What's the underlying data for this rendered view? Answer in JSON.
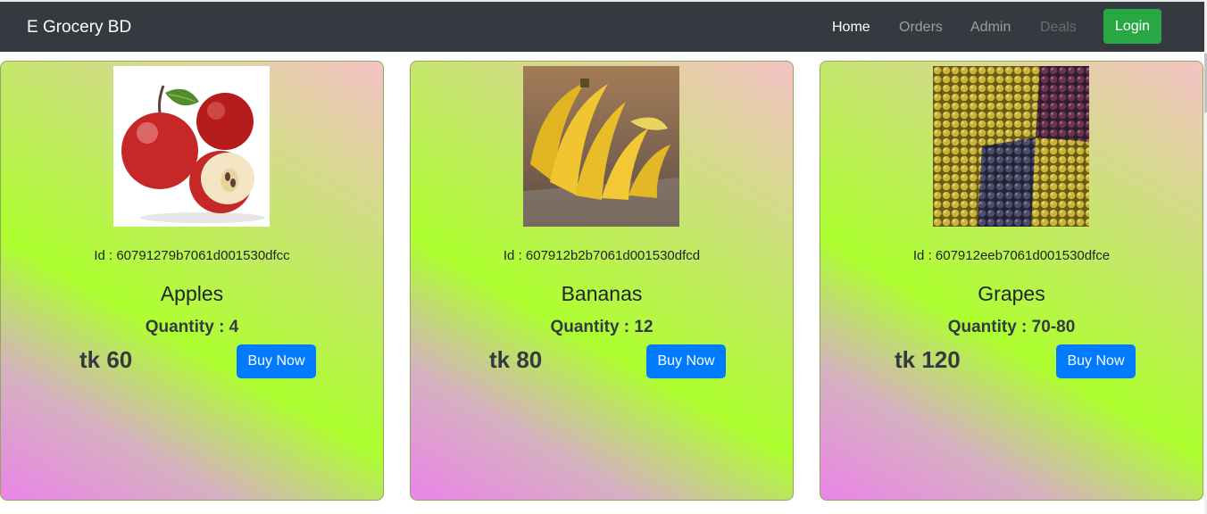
{
  "nav": {
    "brand": "E Grocery BD",
    "links": [
      {
        "label": "Home",
        "state": "active"
      },
      {
        "label": "Orders",
        "state": "normal"
      },
      {
        "label": "Admin",
        "state": "normal"
      },
      {
        "label": "Deals",
        "state": "disabled"
      }
    ],
    "login_label": "Login"
  },
  "colors": {
    "navbar": "#343a40",
    "login": "#28a745",
    "buy": "#007bff",
    "gradient": [
      "#f5c2c7",
      "#adff2f",
      "#ea84e8"
    ]
  },
  "products": [
    {
      "id_text": "Id : 60791279b7061d001530dfcc",
      "name": "Apples",
      "quantity": "Quantity : 4",
      "price": "tk 60",
      "buy_label": "Buy Now",
      "image": "apples-photo"
    },
    {
      "id_text": "Id : 607912b2b7061d001530dfcd",
      "name": "Bananas",
      "quantity": "Quantity : 12",
      "price": "tk 80",
      "buy_label": "Buy Now",
      "image": "bananas-photo"
    },
    {
      "id_text": "Id : 607912eeb7061d001530dfce",
      "name": "Grapes",
      "quantity": "Quantity : 70-80",
      "price": "tk 120",
      "buy_label": "Buy Now",
      "image": "grapes-photo"
    }
  ]
}
